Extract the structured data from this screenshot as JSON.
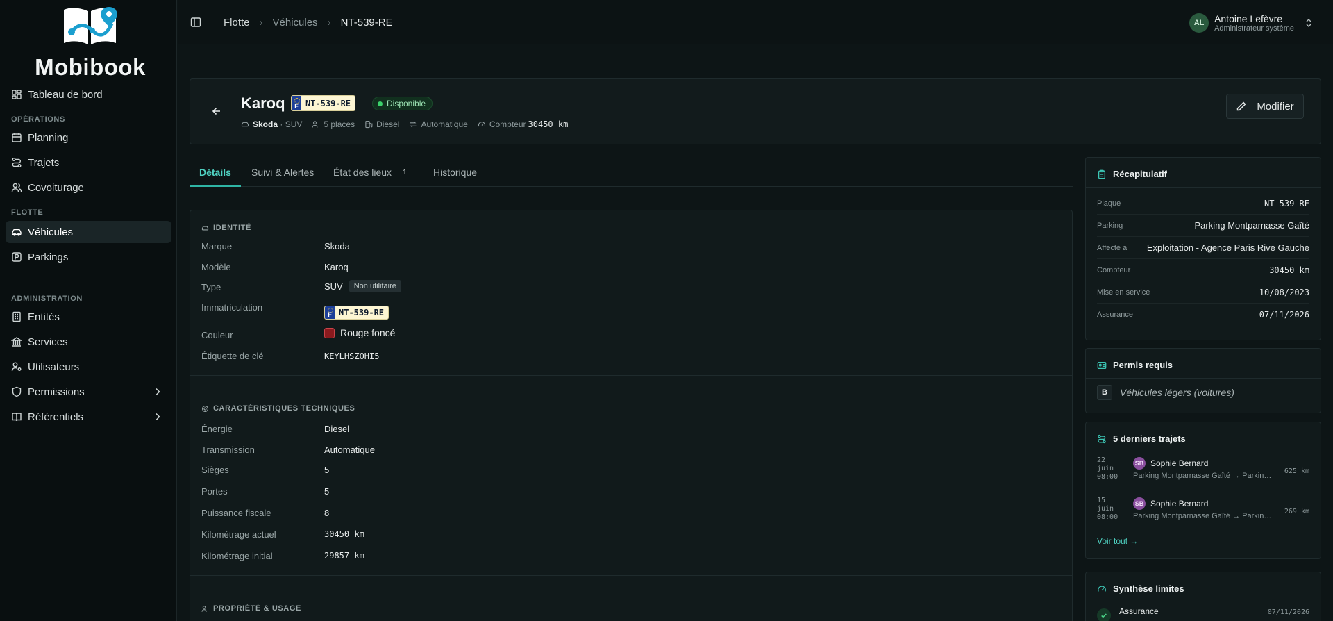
{
  "app": {
    "name": "Mobibook"
  },
  "sidebar": {
    "top_item": "Tableau de bord",
    "sections": {
      "operations": "OPÉRATIONS",
      "flotte": "FLOTTE",
      "administration": "ADMINISTRATION"
    },
    "operations_items": [
      "Planning",
      "Trajets",
      "Covoiturage"
    ],
    "flotte_items": [
      "Véhicules",
      "Parkings"
    ],
    "admin_items": [
      "Entités",
      "Services",
      "Utilisateurs",
      "Permissions",
      "Référentiels"
    ]
  },
  "header": {
    "breadcrumb": [
      "Flotte",
      "Véhicules",
      "NT-539-RE"
    ],
    "user": {
      "initials": "AL",
      "name": "Antoine Lefèvre",
      "role": "Administrateur système"
    }
  },
  "vehicle": {
    "model": "Karoq",
    "plate": "NT-539-RE",
    "plate_country": "F",
    "status": "Disponible",
    "brand": "Skoda",
    "category": "· SUV",
    "seats": "5 places",
    "energy": "Diesel",
    "transmission": "Automatique",
    "counter_label": "Compteur",
    "counter_value": "30450 km",
    "edit_label": "Modifier"
  },
  "tabs": {
    "details": "Détails",
    "suivi": "Suivi & Alertes",
    "etat": "État des lieux",
    "etat_count": "1",
    "historique": "Historique"
  },
  "details": {
    "identite": {
      "title": "IDENTITÉ",
      "marque_label": "Marque",
      "marque": "Skoda",
      "modele_label": "Modèle",
      "modele": "Karoq",
      "type_label": "Type",
      "type": "SUV",
      "type_chip": "Non utilitaire",
      "immat_label": "Immatriculation",
      "immat": "NT-539-RE",
      "couleur_label": "Couleur",
      "couleur": "Rouge foncé",
      "couleur_hex": "#8b1a1e",
      "cle_label": "Étiquette de clé",
      "cle": "KEYLHSZOHI5"
    },
    "tech": {
      "title": "CARACTÉRISTIQUES TECHNIQUES",
      "energie_label": "Énergie",
      "energie": "Diesel",
      "trans_label": "Transmission",
      "trans": "Automatique",
      "sieges_label": "Sièges",
      "sieges": "5",
      "portes_label": "Portes",
      "portes": "5",
      "puissance_label": "Puissance fiscale",
      "puissance": "8",
      "km_actuel_label": "Kilométrage actuel",
      "km_actuel": "30450 km",
      "km_initial_label": "Kilométrage initial",
      "km_initial": "29857 km"
    },
    "propriete": {
      "title": "PROPRIÉTÉ & USAGE"
    }
  },
  "recap": {
    "title": "Récapitulatif",
    "rows": [
      {
        "k": "Plaque",
        "v": "NT-539-RE"
      },
      {
        "k": "Parking",
        "v": "Parking Montparnasse Gaîté"
      },
      {
        "k": "Affecté à",
        "v": "Exploitation - Agence Paris Rive Gauche"
      },
      {
        "k": "Compteur",
        "v": "30450 km"
      },
      {
        "k": "Mise en service",
        "v": "10/08/2023"
      },
      {
        "k": "Assurance",
        "v": "07/11/2026"
      }
    ]
  },
  "permis": {
    "title": "Permis requis",
    "code": "B",
    "label": "Véhicules légers (voitures)"
  },
  "trips": {
    "title": "5 derniers trajets",
    "items": [
      {
        "d1": "22",
        "d2": "juin",
        "d3": "08:00",
        "initials": "SB",
        "name": "Sophie Bernard",
        "route": "Parking Montparnasse Gaîté → Parking Montparnasse Gaîté",
        "km": "625 km"
      },
      {
        "d1": "15",
        "d2": "juin",
        "d3": "08:00",
        "initials": "SB",
        "name": "Sophie Bernard",
        "route": "Parking Montparnasse Gaîté → Parking Montparnasse Gaîté",
        "km": "269 km"
      }
    ],
    "see_all": "Voir tout →"
  },
  "limits": {
    "title": "Synthèse limites",
    "item": "Assurance",
    "date": "07/11/2026"
  },
  "colors": {
    "accent": "#2fb5a5",
    "status_green": "#3bd16b",
    "logo_blue": "#1b9fcf"
  }
}
